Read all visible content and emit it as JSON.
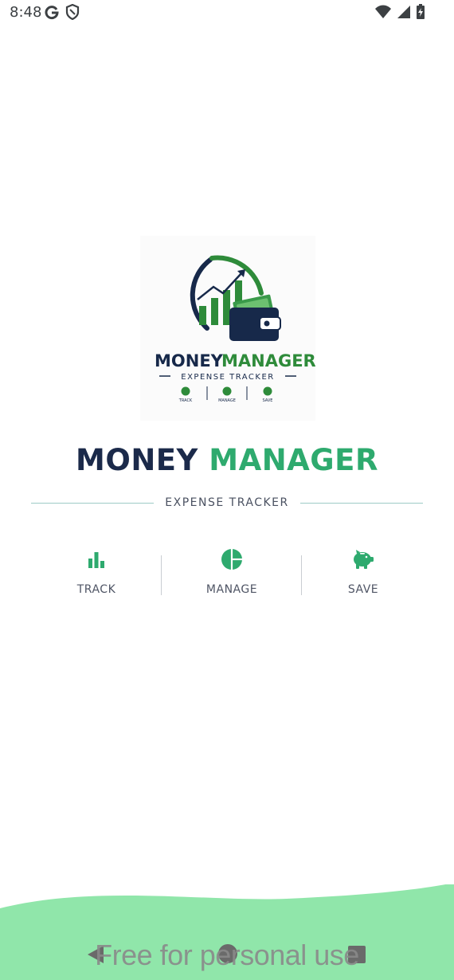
{
  "status_bar": {
    "time": "8:48",
    "left_icons": [
      "google-g-icon",
      "shield-icon"
    ],
    "right_icons": [
      "wifi-icon",
      "signal-icon",
      "battery-charging-icon"
    ]
  },
  "logo": {
    "title_part1": "MONEY",
    "title_part2": "MANAGER",
    "subtitle": "EXPENSE TRACKER",
    "features": [
      "TRACK",
      "MANAGE",
      "SAVE"
    ]
  },
  "title": {
    "part1": "MONEY",
    "part2": "MANAGER"
  },
  "subtitle": "EXPENSE TRACKER",
  "features": [
    {
      "label": "TRACK",
      "icon": "bar-chart-icon"
    },
    {
      "label": "MANAGE",
      "icon": "pie-chart-icon"
    },
    {
      "label": "SAVE",
      "icon": "piggy-bank-icon"
    }
  ],
  "colors": {
    "navy": "#1b2a4a",
    "green": "#2eaa6e",
    "wave": "#90e6aa"
  },
  "watermark": "Free for personal use",
  "nav_bar": {
    "icons": [
      "back-icon",
      "home-icon",
      "recents-icon"
    ]
  }
}
